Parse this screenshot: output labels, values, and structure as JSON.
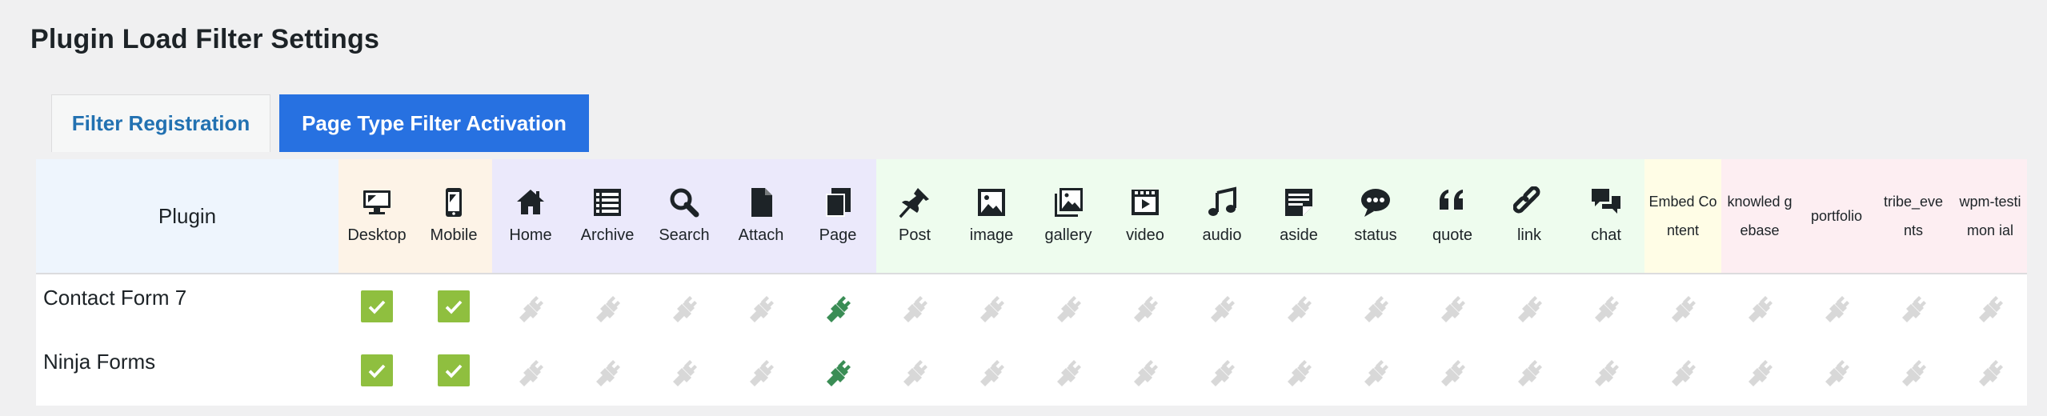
{
  "page_title": "Plugin Load Filter Settings",
  "tabs": [
    {
      "label": "Filter Registration",
      "active": false
    },
    {
      "label": "Page Type Filter Activation",
      "active": true
    }
  ],
  "table": {
    "plugin_header": "Plugin",
    "groups": [
      {
        "name": "device",
        "bg": "#fdf3e7"
      },
      {
        "name": "page-type",
        "bg": "#ebe9fb"
      },
      {
        "name": "post-format",
        "bg": "#eefcee"
      },
      {
        "name": "embed",
        "bg": "#fffde6"
      },
      {
        "name": "custom-post-type",
        "bg": "#fdeef2"
      }
    ],
    "columns": [
      {
        "label": "Desktop",
        "icon": "desktop-icon",
        "group": 0
      },
      {
        "label": "Mobile",
        "icon": "mobile-icon",
        "group": 0
      },
      {
        "label": "Home",
        "icon": "home-icon",
        "group": 1
      },
      {
        "label": "Archive",
        "icon": "archive-icon",
        "group": 1
      },
      {
        "label": "Search",
        "icon": "search-icon",
        "group": 1
      },
      {
        "label": "Attach",
        "icon": "attach-icon",
        "group": 1
      },
      {
        "label": "Page",
        "icon": "page-icon",
        "group": 1
      },
      {
        "label": "Post",
        "icon": "post-icon",
        "group": 2
      },
      {
        "label": "image",
        "icon": "image-icon",
        "group": 2
      },
      {
        "label": "gallery",
        "icon": "gallery-icon",
        "group": 2
      },
      {
        "label": "video",
        "icon": "video-icon",
        "group": 2
      },
      {
        "label": "audio",
        "icon": "audio-icon",
        "group": 2
      },
      {
        "label": "aside",
        "icon": "aside-icon",
        "group": 2
      },
      {
        "label": "status",
        "icon": "status-icon",
        "group": 2
      },
      {
        "label": "quote",
        "icon": "quote-icon",
        "group": 2
      },
      {
        "label": "link",
        "icon": "link-icon",
        "group": 2
      },
      {
        "label": "chat",
        "icon": "chat-icon",
        "group": 2
      },
      {
        "label": "Embed Content",
        "icon": "",
        "group": 3
      },
      {
        "label": "knowled gebase",
        "icon": "",
        "group": 4
      },
      {
        "label": "portfolio",
        "icon": "",
        "group": 4
      },
      {
        "label": "tribe_eve nts",
        "icon": "",
        "group": 4
      },
      {
        "label": "wpm-testimon ial",
        "icon": "",
        "group": 4
      }
    ],
    "rows": [
      {
        "name": "Contact Form 7",
        "cells": [
          "check",
          "check",
          "off",
          "off",
          "off",
          "off",
          "on",
          "off",
          "off",
          "off",
          "off",
          "off",
          "off",
          "off",
          "off",
          "off",
          "off",
          "off",
          "off",
          "off",
          "off",
          "off"
        ]
      },
      {
        "name": "Ninja Forms",
        "cells": [
          "check",
          "check",
          "off",
          "off",
          "off",
          "off",
          "on",
          "off",
          "off",
          "off",
          "off",
          "off",
          "off",
          "off",
          "off",
          "off",
          "off",
          "off",
          "off",
          "off",
          "off",
          "off"
        ]
      }
    ]
  },
  "colors": {
    "accent": "#2771e1",
    "check_bg": "#8fbf3f",
    "plug_on": "#3a8d55",
    "plug_off": "#d8d8d8"
  }
}
